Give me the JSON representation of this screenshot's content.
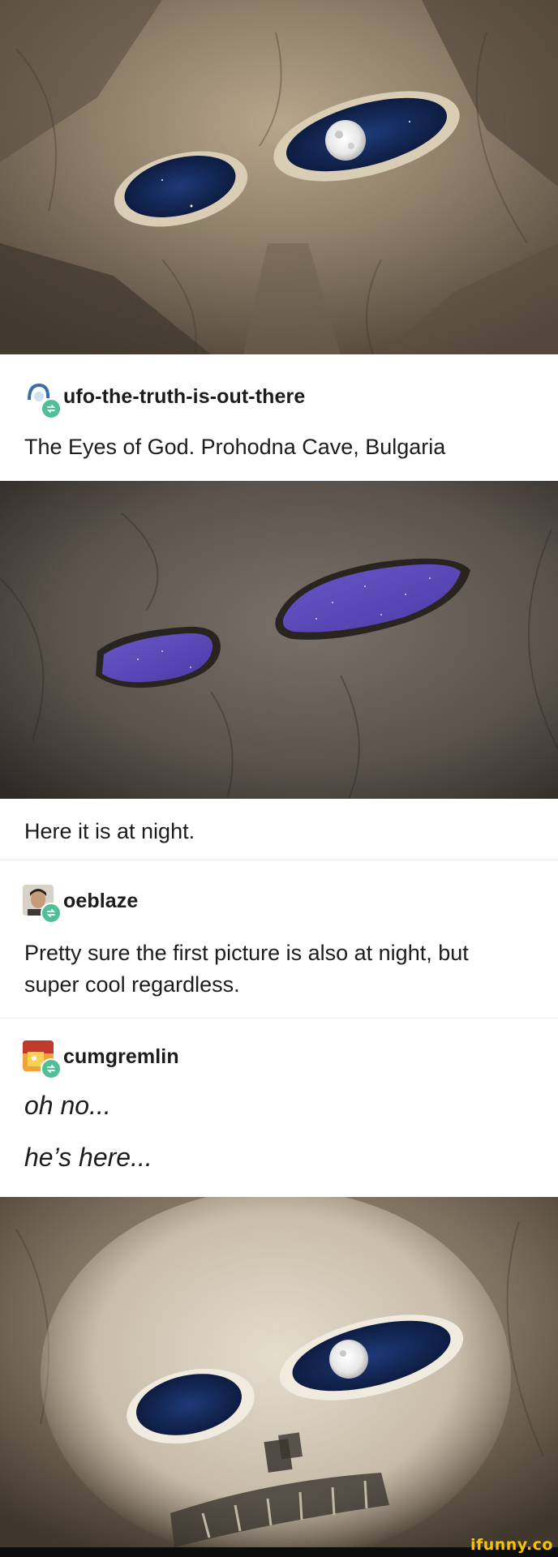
{
  "posts": [
    {
      "username": "ufo-the-truth-is-out-there",
      "text": "The Eyes of God. Prohodna Cave, Bulgaria"
    },
    {
      "text": "Here it is at night."
    },
    {
      "username": "oeblaze",
      "text_line1": "Pretty sure the first picture is also at night, but",
      "text_line2": "super cool regardless."
    },
    {
      "username": "cumgremlin",
      "line1": "oh no...",
      "line2": "he’s here..."
    }
  ],
  "photos": [
    {
      "name": "cave-eyes-day-photo",
      "icon": "moon-icon"
    },
    {
      "name": "cave-eyes-night-photo",
      "icon": "starry-sky"
    },
    {
      "name": "cave-skull-edit-photo",
      "icon": "moon-icon"
    }
  ],
  "colors": {
    "reblog_badge": "#4fbf96",
    "watermark": "#f5c400"
  },
  "watermark": "ifunny.co"
}
